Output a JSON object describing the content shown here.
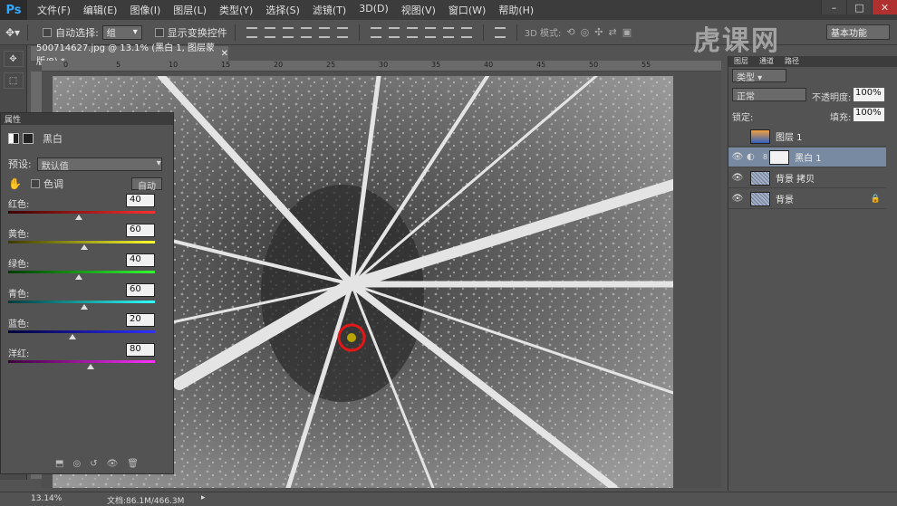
{
  "menubar": {
    "logo": "Ps",
    "items": [
      "文件(F)",
      "编辑(E)",
      "图像(I)",
      "图层(L)",
      "类型(Y)",
      "选择(S)",
      "滤镜(T)",
      "3D(D)",
      "视图(V)",
      "窗口(W)",
      "帮助(H)"
    ]
  },
  "optbar": {
    "auto_select_label": "自动选择:",
    "auto_select_value": "组",
    "show_transform_label": "显示变换控件",
    "mode_3d_label": "3D 模式:",
    "workspace": "基本功能"
  },
  "document": {
    "tab_title": "500714627.jpg @ 13.1% (黑白 1, 图层蒙版/8) *",
    "ruler_marks": [
      "0",
      "5",
      "10",
      "15",
      "20",
      "25",
      "30",
      "35",
      "40",
      "45",
      "50",
      "55"
    ]
  },
  "properties": {
    "panel_title": "属性",
    "adjustment_name": "黑白",
    "preset_label": "预设:",
    "preset_value": "默认值",
    "tint_label": "色调",
    "auto_label": "自动",
    "sliders": [
      {
        "label": "红色:",
        "value": "40",
        "pos": 0.48,
        "color_from": "#3a0000",
        "color_to": "#ff3030"
      },
      {
        "label": "黄色:",
        "value": "60",
        "pos": 0.52,
        "color_from": "#3a3a00",
        "color_to": "#ffff30"
      },
      {
        "label": "绿色:",
        "value": "40",
        "pos": 0.48,
        "color_from": "#003a00",
        "color_to": "#30ff30"
      },
      {
        "label": "青色:",
        "value": "60",
        "pos": 0.52,
        "color_from": "#003a3a",
        "color_to": "#30ffff"
      },
      {
        "label": "蓝色:",
        "value": "20",
        "pos": 0.44,
        "color_from": "#00003a",
        "color_to": "#3030ff"
      },
      {
        "label": "洋红:",
        "value": "80",
        "pos": 0.56,
        "color_from": "#3a003a",
        "color_to": "#ff30ff"
      }
    ]
  },
  "layers": {
    "panel_tabs": [
      "图层",
      "通道",
      "路径"
    ],
    "kind_label": "类型",
    "blend_mode": "正常",
    "opacity_label": "不透明度:",
    "opacity_value": "100%",
    "lock_label": "锁定:",
    "fill_label": "填充:",
    "fill_value": "100%",
    "items": [
      {
        "name": "图层 1",
        "visible": false,
        "selected": false
      },
      {
        "name": "黑白 1",
        "visible": true,
        "selected": true
      },
      {
        "name": "背景 拷贝",
        "visible": true,
        "selected": false
      },
      {
        "name": "背景",
        "visible": true,
        "selected": false
      }
    ]
  },
  "status": {
    "zoom": "13.14%",
    "doc_size": "文档:86.1M/466.3M"
  },
  "watermark": "虎课网"
}
